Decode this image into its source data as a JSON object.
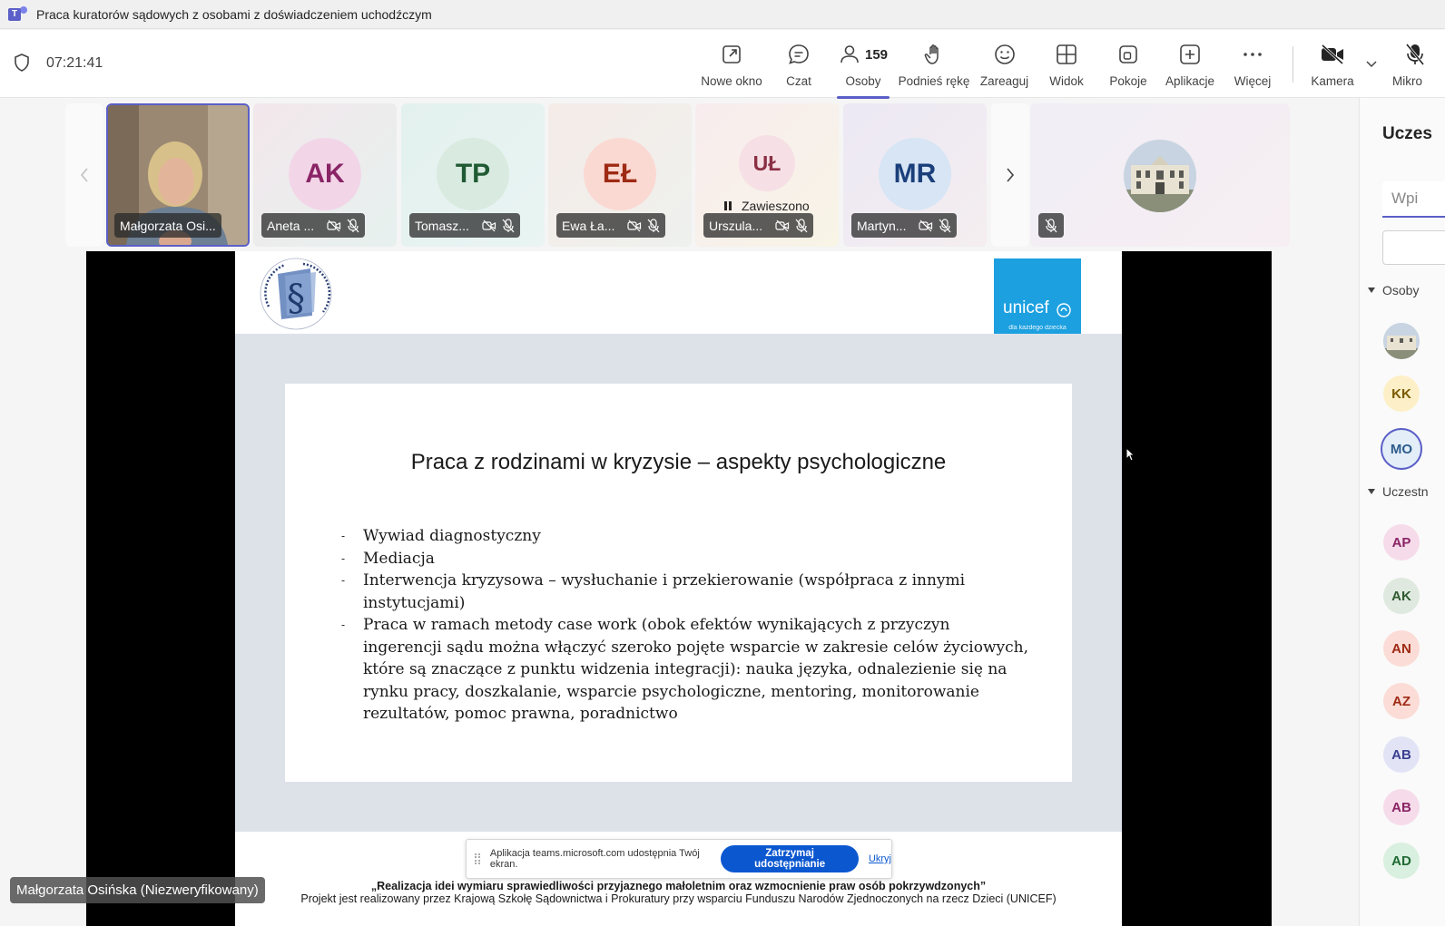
{
  "window": {
    "title": "Praca kuratorów sądowych z osobami z doświadczeniem uchodźczym"
  },
  "toolbar": {
    "timer": "07:21:41",
    "people_count": "159",
    "buttons": {
      "new_window": "Nowe okno",
      "chat": "Czat",
      "people": "Osoby",
      "raise_hand": "Podnieś rękę",
      "react": "Zareaguj",
      "view": "Widok",
      "rooms": "Pokoje",
      "apps": "Aplikacje",
      "more": "Więcej",
      "camera": "Kamera",
      "mic": "Mikro"
    }
  },
  "participants": [
    {
      "name": "Małgorzata Osi...",
      "initials": "",
      "video": true
    },
    {
      "name": "Aneta ...",
      "initials": "AK",
      "bg": "#f2d6e8",
      "fg": "#8a2466"
    },
    {
      "name": "Tomasz...",
      "initials": "TP",
      "bg": "#d9ebe0",
      "fg": "#1f5a33"
    },
    {
      "name": "Ewa Ła...",
      "initials": "EŁ",
      "bg": "#fbd9d3",
      "fg": "#9e2a14"
    },
    {
      "name": "Urszula...",
      "initials": "UŁ",
      "bg": "#f6e0e6",
      "fg": "#8b2f45",
      "status": "Zawieszono"
    },
    {
      "name": "Martyn...",
      "initials": "MR",
      "bg": "#d7e5f5",
      "fg": "#1b3f7a"
    }
  ],
  "slide": {
    "heading": "Praca z rodzinami w kryzysie – aspekty psychologiczne",
    "bullets": [
      "Wywiad diagnostyczny",
      "Mediacja",
      "Interwencja kryzysowa – wysłuchanie i przekierowanie (współpraca z innymi instytucjami)",
      "Praca w ramach metody case work (obok efektów wynikających z przyczyn ingerencji sądu można włączyć szeroko pojęte wsparcie w zakresie celów życiowych, które są znaczące z punktu widzenia integracji): nauka języka, odnalezienie się na rynku pracy, doszkalanie, wsparcie psychologiczne, mentoring, monitorowanie rezultatów, pomoc prawna, poradnictwo"
    ],
    "footer_line1": "„Realizacja idei wymiaru sprawiedliwości przyjaznego małoletnim oraz wzmocnienie praw osób pokrzywdzonych”",
    "footer_line2": "Projekt jest realizowany przez Krajową Szkołę Sądownictwa i Prokuratury przy wsparciu  Funduszu Narodów Zjednoczonych na rzecz Dzieci (UNICEF)",
    "logo_left_text": "KRAJOWA SZKOŁA SĄDOWNICTWA I PROKURATURY",
    "logo_right_text": "unicef",
    "logo_right_sub": "dla każdego dziecka"
  },
  "sharebar": {
    "text": "Aplikacja teams.microsoft.com udostępnia Twój ekran.",
    "stop": "Zatrzymaj udostępnianie",
    "hide": "Ukryj"
  },
  "speaker": "Małgorzata Osińska (Niezweryfikowany)",
  "right_panel": {
    "title": "Uczes",
    "search_placeholder": "Wpi",
    "section_people": "Osoby",
    "section_participants": "Uczestn",
    "people": [
      {
        "initials": "KK",
        "bg": "#fdf0c8",
        "fg": "#7a5a00"
      },
      {
        "initials": "MO",
        "bg": "#e3eef8",
        "fg": "#2c5b8c"
      }
    ],
    "participants": [
      {
        "initials": "AP",
        "bg": "#f6dcea",
        "fg": "#8a2466"
      },
      {
        "initials": "AK",
        "bg": "#dfe9df",
        "fg": "#2f5a2f"
      },
      {
        "initials": "AN",
        "bg": "#fbdcd6",
        "fg": "#9e2a14"
      },
      {
        "initials": "AZ",
        "bg": "#fbdcd6",
        "fg": "#9e2a14"
      },
      {
        "initials": "AB",
        "bg": "#e2e4f6",
        "fg": "#3b3f8f"
      },
      {
        "initials": "AB",
        "bg": "#f6dcea",
        "fg": "#8a2466"
      },
      {
        "initials": "AD",
        "bg": "#d9efdf",
        "fg": "#1f6a33"
      }
    ]
  }
}
